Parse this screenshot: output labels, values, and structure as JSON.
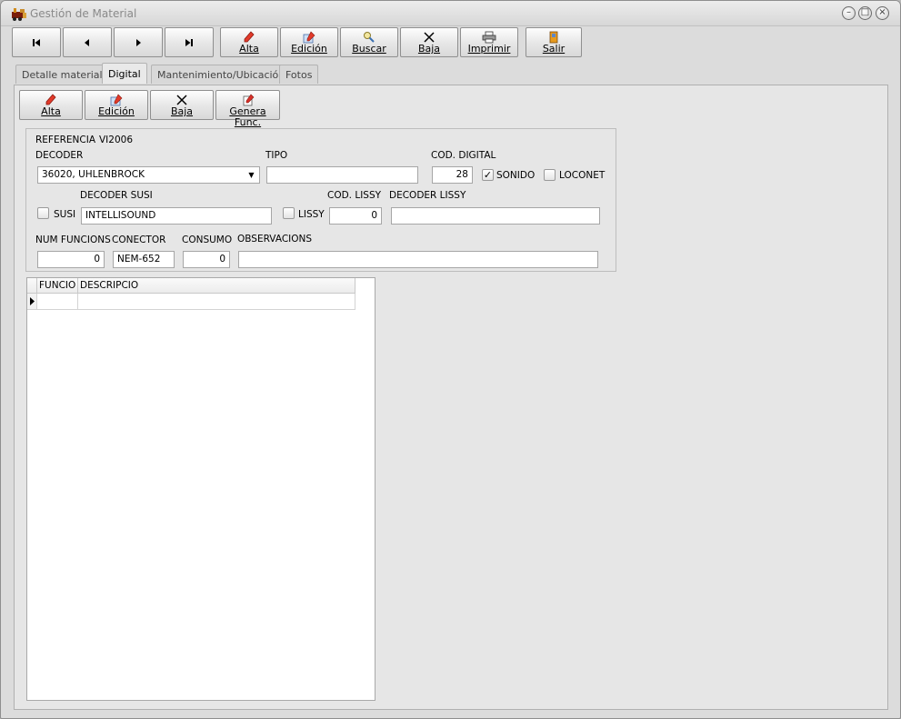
{
  "window": {
    "title": "Gestión de Material"
  },
  "toolbar": {
    "nav_first": "first-record-icon",
    "nav_prev": "previous-record-icon",
    "nav_next": "next-record-icon",
    "nav_last": "last-record-icon",
    "alta": "Alta",
    "edicion": "Edición",
    "buscar": "Buscar",
    "baja": "Baja",
    "imprimir": "Imprimir",
    "salir": "Salir"
  },
  "tabs": [
    "Detalle material",
    "Digital",
    "Mantenimiento/Ubicación",
    "Fotos"
  ],
  "digital_toolbar": {
    "alta": "Alta",
    "edicion": "Edición",
    "baja": "Baja",
    "genera": "Genera Func."
  },
  "form": {
    "referencia_label": "REFERENCIA",
    "referencia_value": "VI2006",
    "decoder_label": "DECODER",
    "decoder_value": "36020, UHLENBROCK",
    "tipo_label": "TIPO",
    "tipo_value": "",
    "cod_digital_label": "COD. DIGITAL",
    "cod_digital_value": "28",
    "sonido_label": "SONIDO",
    "sonido_checked": true,
    "loconet_label": "LOCONET",
    "loconet_checked": false,
    "susi_label": "SUSI",
    "susi_checked": false,
    "decoder_susi_label": "DECODER SUSI",
    "decoder_susi_value": "INTELLISOUND",
    "lissy_label": "LISSY",
    "lissy_checked": false,
    "cod_lissy_label": "COD. LISSY",
    "cod_lissy_value": "0",
    "decoder_lissy_label": "DECODER LISSY",
    "decoder_lissy_value": "",
    "num_funcions_label": "NUM FUNCIONS",
    "num_funcions_value": "0",
    "conector_label": "CONECTOR",
    "conector_value": "NEM-652",
    "consumo_label": "CONSUMO",
    "consumo_value": "0",
    "observacions_label": "OBSERVACIONS",
    "observacions_value": ""
  },
  "grid": {
    "columns": [
      "FUNCIO",
      "DESCRIPCIO"
    ],
    "rows": [
      [
        "",
        ""
      ]
    ]
  }
}
